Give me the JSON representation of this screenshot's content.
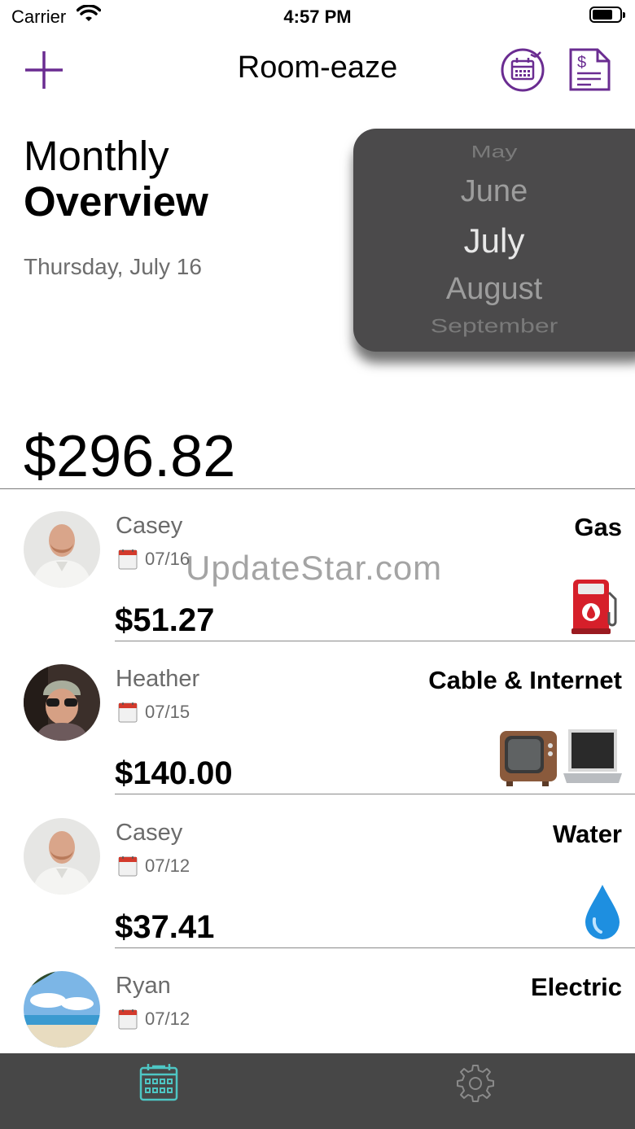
{
  "status_bar": {
    "carrier": "Carrier",
    "time": "4:57 PM"
  },
  "nav": {
    "title": "Room-eaze",
    "add_icon": "plus-icon",
    "calendar_icon": "calendar-refresh-icon",
    "bill_icon": "dollar-document-icon"
  },
  "header": {
    "line1": "Monthly",
    "line2": "Overview",
    "date": "Thursday, July 16"
  },
  "month_picker": {
    "options": [
      "May",
      "June",
      "July",
      "August",
      "September"
    ],
    "selected": "July"
  },
  "total": "$296.82",
  "bills": [
    {
      "payer": "Casey",
      "date": "07/16",
      "amount": "$51.27",
      "category": "Gas",
      "icon": "fuel-pump-icon"
    },
    {
      "payer": "Heather",
      "date": "07/15",
      "amount": "$140.00",
      "category": "Cable & Internet",
      "icon": "tv-laptop-icon"
    },
    {
      "payer": "Casey",
      "date": "07/12",
      "amount": "$37.41",
      "category": "Water",
      "icon": "water-drop-icon"
    },
    {
      "payer": "Ryan",
      "date": "07/12",
      "amount": "",
      "category": "Electric",
      "icon": "light-bulb-icon"
    }
  ],
  "watermark": "UpdateStar.com",
  "tab_bar": {
    "tabs": [
      "calendar-tab",
      "settings-tab"
    ],
    "active": "calendar-tab"
  },
  "colors": {
    "accent": "#6a2c91",
    "tab_active": "#4ec6c4",
    "tab_inactive": "#8a8a8a",
    "tab_bar_bg": "#474747",
    "picker_bg": "#4b4a4b"
  }
}
